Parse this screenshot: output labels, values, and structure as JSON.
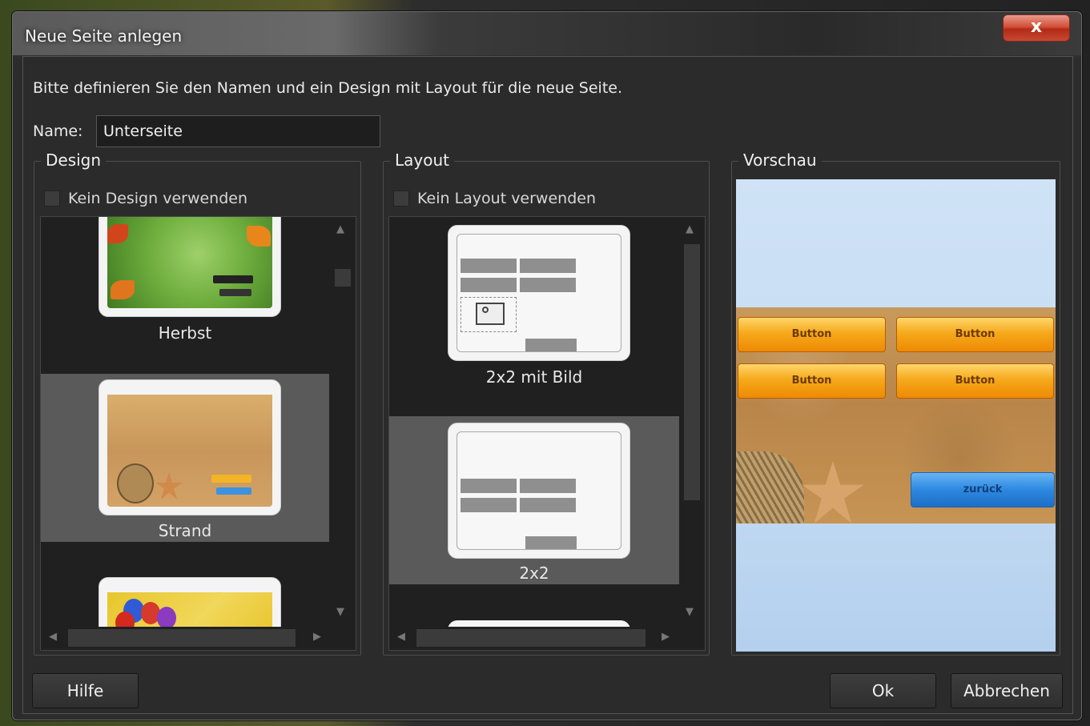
{
  "window": {
    "title": "Neue Seite anlegen",
    "close_label": "x"
  },
  "intro": "Bitte definieren Sie den Namen und ein Design mit Layout für die neue Seite.",
  "name": {
    "label": "Name:",
    "value": "Unterseite"
  },
  "design": {
    "title": "Design",
    "checkbox_label": "Kein Design verwenden",
    "items": [
      {
        "label": "Herbst"
      },
      {
        "label": "Strand"
      },
      {
        "label": ""
      }
    ]
  },
  "layout": {
    "title": "Layout",
    "checkbox_label": "Kein Layout verwenden",
    "items": [
      {
        "label": "2x2 mit Bild"
      },
      {
        "label": "2x2"
      }
    ]
  },
  "preview": {
    "title": "Vorschau",
    "buttons": [
      "Button",
      "Button",
      "Button",
      "Button"
    ],
    "back_button": "zurück"
  },
  "footer": {
    "help": "Hilfe",
    "ok": "Ok",
    "cancel": "Abbrechen"
  }
}
